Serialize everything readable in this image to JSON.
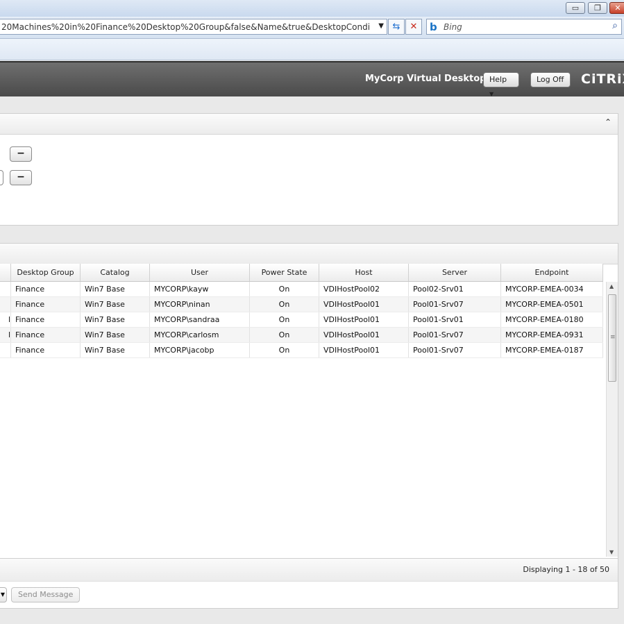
{
  "browser": {
    "window_controls": {
      "minimize": "▭",
      "restore": "❐",
      "close": "✕"
    },
    "address": "20Machines%20in%20Finance%20Desktop%20Group&false&Name&true&DesktopConditions~Enum",
    "search_placeholder": "Bing"
  },
  "header": {
    "title": "MyCorp Virtual Desktops",
    "help_label": "Help",
    "logoff_label": "Log Off",
    "logo_text": "CiTRiX"
  },
  "grid": {
    "columns": [
      "Desktop Group",
      "Catalog",
      "User",
      "Power State",
      "Host",
      "Server",
      "Endpoint"
    ],
    "rows": [
      {
        "stub": "",
        "group": "Finance",
        "catalog": "Win7 Base",
        "user": "MYCORP\\kayw",
        "power": "On",
        "host": "VDIHostPool02",
        "server": "Pool02-Srv01",
        "endpoint": "MYCORP-EMEA-0034"
      },
      {
        "stub": "",
        "group": "Finance",
        "catalog": "Win7 Base",
        "user": "MYCORP\\ninan",
        "power": "On",
        "host": "VDIHostPool01",
        "server": "Pool01-Srv07",
        "endpoint": "MYCORP-EMEA-0501"
      },
      {
        "stub": "l",
        "group": "Finance",
        "catalog": "Win7 Base",
        "user": "MYCORP\\sandraa",
        "power": "On",
        "host": "VDIHostPool01",
        "server": "Pool01-Srv01",
        "endpoint": "MYCORP-EMEA-0180"
      },
      {
        "stub": "l",
        "group": "Finance",
        "catalog": "Win7 Base",
        "user": "MYCORP\\carlosm",
        "power": "On",
        "host": "VDIHostPool01",
        "server": "Pool01-Srv07",
        "endpoint": "MYCORP-EMEA-0931"
      },
      {
        "stub": "",
        "group": "Finance",
        "catalog": "Win7 Base",
        "user": "MYCORP\\jacobp",
        "power": "On",
        "host": "VDIHostPool01",
        "server": "Pool01-Srv07",
        "endpoint": "MYCORP-EMEA-0187"
      }
    ],
    "pager_text": "Displaying 1 - 18 of 50",
    "send_message_label": "Send Message"
  }
}
